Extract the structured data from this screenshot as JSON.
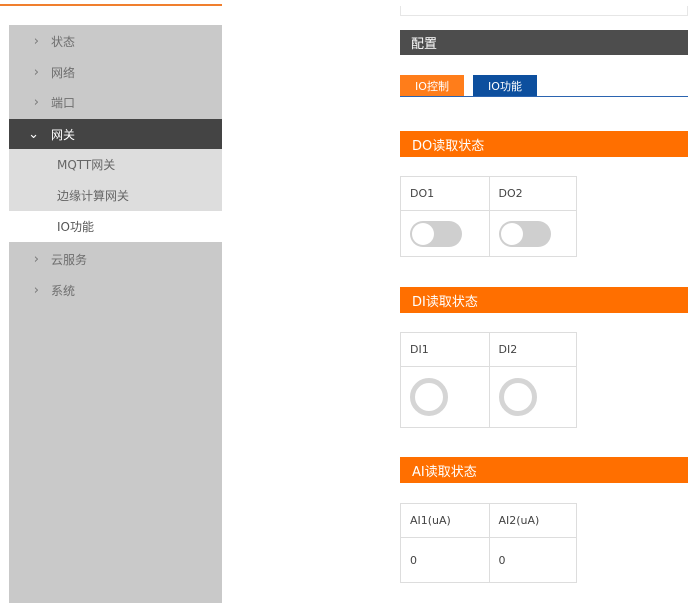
{
  "sidebar": {
    "items": [
      {
        "label": "状态",
        "chevron": "›"
      },
      {
        "label": "网络",
        "chevron": "›"
      },
      {
        "label": "端口",
        "chevron": "›"
      },
      {
        "label": "网关",
        "chevron": "⌄"
      },
      {
        "label": "云服务",
        "chevron": "›"
      },
      {
        "label": "系统",
        "chevron": "›"
      }
    ],
    "sub_items": [
      {
        "label": "MQTT网关"
      },
      {
        "label": "边缘计算网关"
      },
      {
        "label": "IO功能"
      }
    ]
  },
  "main": {
    "config_title": "配置",
    "tabs": [
      {
        "label": "IO控制"
      },
      {
        "label": "IO功能"
      }
    ],
    "do_section": {
      "title": "DO读取状态",
      "headers": [
        "DO1",
        "DO2"
      ],
      "states": [
        "off",
        "off"
      ]
    },
    "di_section": {
      "title": "DI读取状态",
      "headers": [
        "DI1",
        "DI2"
      ],
      "states": [
        "off",
        "off"
      ]
    },
    "ai_section": {
      "title": "AI读取状态",
      "headers": [
        "AI1(uA)",
        "AI2(uA)"
      ],
      "values": [
        "0",
        "0"
      ]
    }
  },
  "colors": {
    "accent_orange": "#ff6f00",
    "tab_active": "#ff7d1a",
    "tab_inactive": "#0d4f9e",
    "sidebar_active": "#444444"
  }
}
